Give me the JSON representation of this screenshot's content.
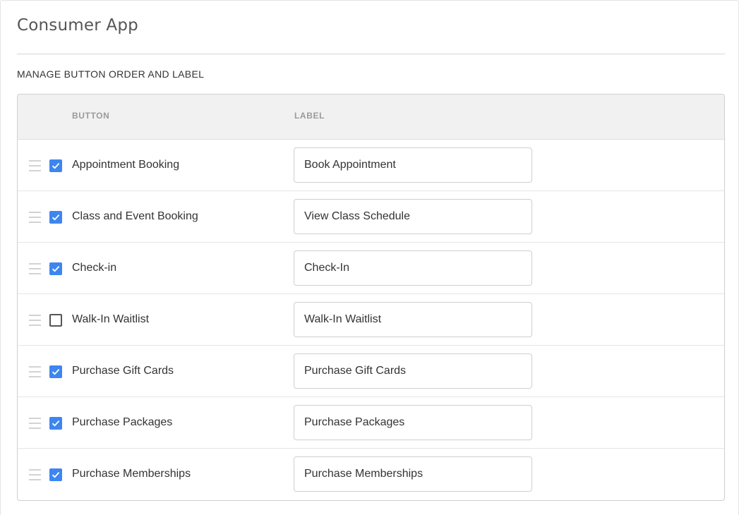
{
  "page": {
    "title": "Consumer App",
    "section_heading": "MANAGE BUTTON ORDER AND LABEL"
  },
  "table": {
    "headers": {
      "button": "BUTTON",
      "label": "LABEL"
    },
    "rows": [
      {
        "name": "Appointment Booking",
        "label": "Book Appointment",
        "checked": true
      },
      {
        "name": "Class and Event Booking",
        "label": "View Class Schedule",
        "checked": true
      },
      {
        "name": "Check-in",
        "label": "Check-In",
        "checked": true
      },
      {
        "name": "Walk-In Waitlist",
        "label": "Walk-In Waitlist",
        "checked": false
      },
      {
        "name": "Purchase Gift Cards",
        "label": "Purchase Gift Cards",
        "checked": true
      },
      {
        "name": "Purchase Packages",
        "label": "Purchase Packages",
        "checked": true
      },
      {
        "name": "Purchase Memberships",
        "label": "Purchase Memberships",
        "checked": true
      }
    ]
  },
  "icons": {
    "drag": "drag-handle-icon",
    "check": "checkmark-icon"
  },
  "colors": {
    "checkbox_checked": "#3d86f0",
    "header_bg": "#f1f1f1"
  }
}
